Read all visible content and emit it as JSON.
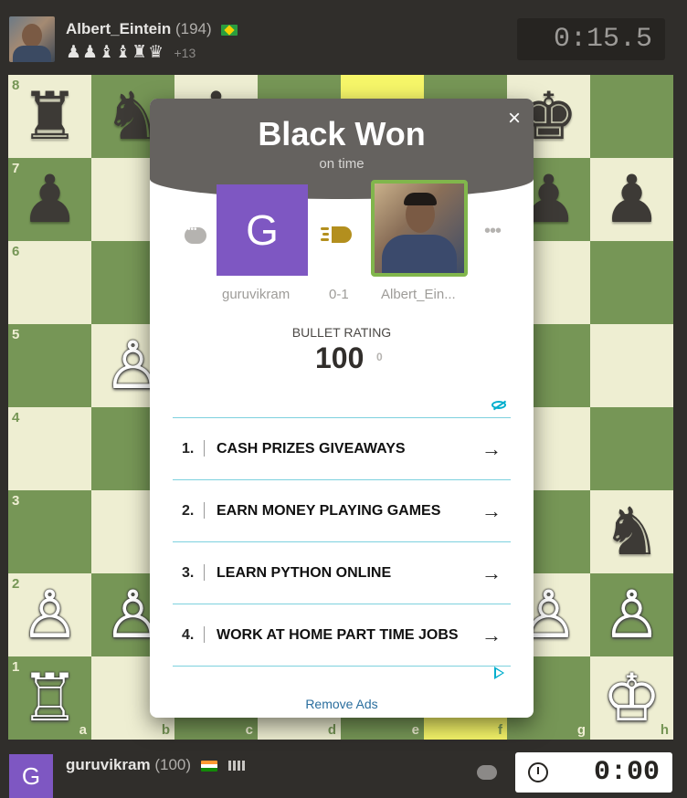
{
  "top_player": {
    "name": "Albert_Eintein",
    "rating": "(194)",
    "flag_icon": "brazil-flag-icon",
    "captured_pieces": "♟♟♝♝♜♛",
    "material_advantage": "+13",
    "clock": "0:15.5"
  },
  "bottom_player": {
    "name": "guruvikram",
    "rating": "(100)",
    "avatar_letter": "G",
    "flag_icon": "india-flag-icon",
    "clock": "0:00"
  },
  "board": {
    "files": [
      "a",
      "b",
      "c",
      "d",
      "e",
      "f",
      "g",
      "h"
    ],
    "ranks": [
      "8",
      "7",
      "6",
      "5",
      "4",
      "3",
      "2",
      "1"
    ],
    "highlight_squares": [
      "e8",
      "f1"
    ],
    "pieces": [
      {
        "sq": "a8",
        "p": "♜",
        "c": "b"
      },
      {
        "sq": "b8",
        "p": "♞",
        "c": "b"
      },
      {
        "sq": "c8",
        "p": "♝",
        "c": "b"
      },
      {
        "sq": "g8",
        "p": "♚",
        "c": "b"
      },
      {
        "sq": "a7",
        "p": "♟",
        "c": "b"
      },
      {
        "sq": "g7",
        "p": "♟",
        "c": "b"
      },
      {
        "sq": "h7",
        "p": "♟",
        "c": "b"
      },
      {
        "sq": "b5",
        "p": "♙",
        "c": "w"
      },
      {
        "sq": "h3",
        "p": "♞",
        "c": "b"
      },
      {
        "sq": "a2",
        "p": "♙",
        "c": "w"
      },
      {
        "sq": "b2",
        "p": "♙",
        "c": "w"
      },
      {
        "sq": "g2",
        "p": "♙",
        "c": "w"
      },
      {
        "sq": "h2",
        "p": "♙",
        "c": "w"
      },
      {
        "sq": "a1",
        "p": "♖",
        "c": "w"
      },
      {
        "sq": "h1",
        "p": "♔",
        "c": "w"
      }
    ]
  },
  "modal": {
    "title": "Black Won",
    "subtitle": "on time",
    "close_label": "×",
    "white_player": {
      "name": "guruvikram",
      "avatar_letter": "G"
    },
    "black_player": {
      "name": "Albert_Ein..."
    },
    "score": "0-1",
    "game_type_icon": "bullet-icon",
    "rating_label": "BULLET RATING",
    "rating_value": "100",
    "rating_change": "0",
    "more_label": "•••",
    "ads": [
      {
        "num": "1.",
        "text": "CASH PRIZES GIVEAWAYS"
      },
      {
        "num": "2.",
        "text": "EARN MONEY PLAYING GAMES"
      },
      {
        "num": "3.",
        "text": "LEARN PYTHON ONLINE"
      },
      {
        "num": "4.",
        "text": "WORK AT HOME PART TIME JOBS"
      }
    ],
    "ad_arrow": "→",
    "remove_ads": "Remove Ads"
  },
  "colors": {
    "light_square": "#eeeed2",
    "dark_square": "#769656",
    "highlight": "#f6f669",
    "win_border": "#81b64c"
  }
}
